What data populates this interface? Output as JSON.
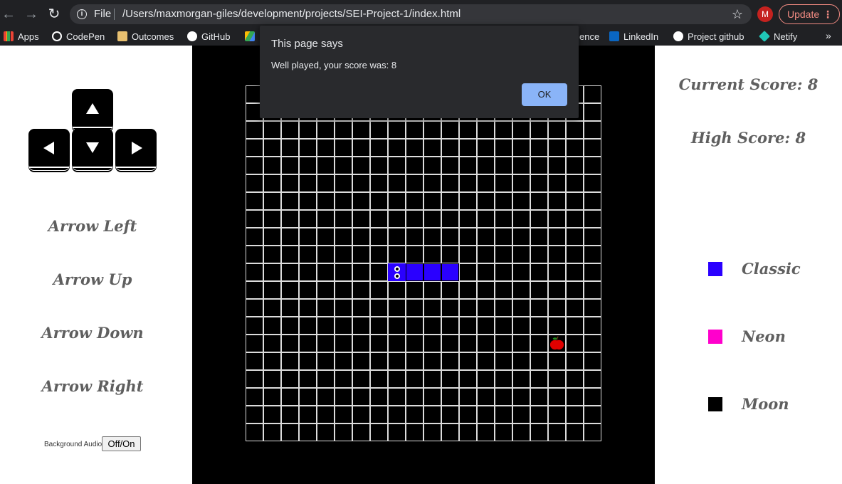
{
  "browser": {
    "file_label": "File",
    "url": "/Users/maxmorgan-giles/development/projects/SEI-Project-1/index.html",
    "avatar_initial": "M",
    "update_label": "Update",
    "bookmarks": [
      {
        "label": "Apps",
        "icon": "apps-grid-icon",
        "color": "#f4b400"
      },
      {
        "label": "CodePen",
        "icon": "codepen-icon",
        "color": "#ffffff"
      },
      {
        "label": "Outcomes",
        "icon": "outcomes-icon",
        "color": "#e8c070"
      },
      {
        "label": "GitHub",
        "icon": "github-icon",
        "color": "#ffffff"
      },
      {
        "label": "ence",
        "icon": "",
        "color": ""
      },
      {
        "label": "LinkedIn",
        "icon": "linkedin-icon",
        "color": "#0a66c2"
      },
      {
        "label": "Project github",
        "icon": "github-icon",
        "color": "#ffffff"
      },
      {
        "label": "Netify",
        "icon": "netlify-icon",
        "color": "#20c6b7"
      }
    ]
  },
  "dialog": {
    "title": "This page says",
    "message": "Well played, your score was: 8",
    "ok_label": "OK"
  },
  "controls": {
    "labels": [
      "Arrow Left",
      "Arrow Up",
      "Arrow Down",
      "Arrow Right"
    ],
    "audio_label": "Background Audio",
    "audio_button": "Off/On"
  },
  "scores": {
    "current": "Current Score: 8",
    "high": "High Score: 8"
  },
  "themes": [
    {
      "label": "Classic",
      "color": "#2a00ff"
    },
    {
      "label": "Neon",
      "color": "#ff00cc"
    },
    {
      "label": "Moon",
      "color": "#000000"
    }
  ],
  "game": {
    "grid_size": 20,
    "snake_color": "#2a00ff",
    "snake_cells": [
      [
        8,
        10
      ],
      [
        9,
        10
      ],
      [
        10,
        10
      ],
      [
        11,
        10
      ]
    ],
    "apple_cell": [
      17,
      14
    ]
  }
}
